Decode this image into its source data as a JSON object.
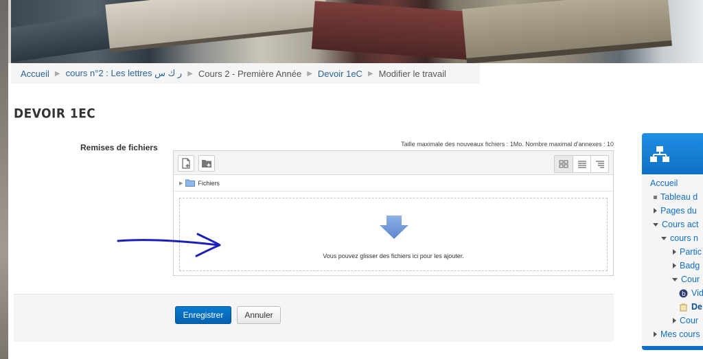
{
  "breadcrumb": {
    "items": [
      "Accueil",
      "cours n°2 : Les lettres ر ك س",
      "Cours 2 - Première Année",
      "Devoir 1eC",
      "Modifier le travail"
    ]
  },
  "page": {
    "title": "DEVOIR 1EC"
  },
  "form": {
    "field_label": "Remises de fichiers",
    "limits_text": "Taille maximale des nouveaux fichiers : 1Mo. Nombre maximal d'annexes : 10",
    "folder_label": "Fichiers",
    "drop_text": "Vous pouvez glisser des fichiers ici pour les ajouter.",
    "save_label": "Enregistrer",
    "cancel_label": "Annuler"
  },
  "navigation": {
    "items": [
      "Accueil",
      "Tableau d",
      "Pages du",
      "Cours act",
      "cours n",
      "Partic",
      "Badg",
      "Cour",
      "Vid",
      "De",
      "Cour",
      "Mes cours"
    ]
  },
  "colors": {
    "accent": "#0f6fc6",
    "link": "#2a6496",
    "annotation": "#1a1fb8"
  }
}
